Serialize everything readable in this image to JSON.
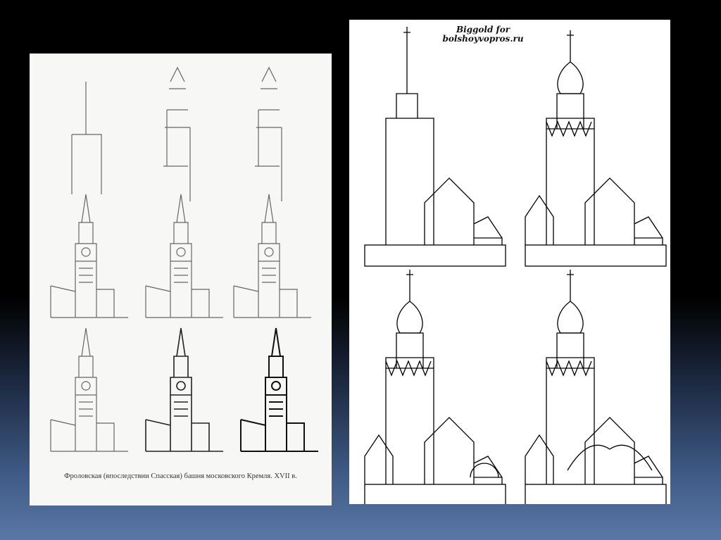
{
  "left_image": {
    "caption": "Фроловская (впоследствии Спасская) башня московского Кремля. XVII в."
  },
  "right_image": {
    "credit_line1": "Biggold for",
    "credit_line2": "bolshoyvopros.ru"
  }
}
